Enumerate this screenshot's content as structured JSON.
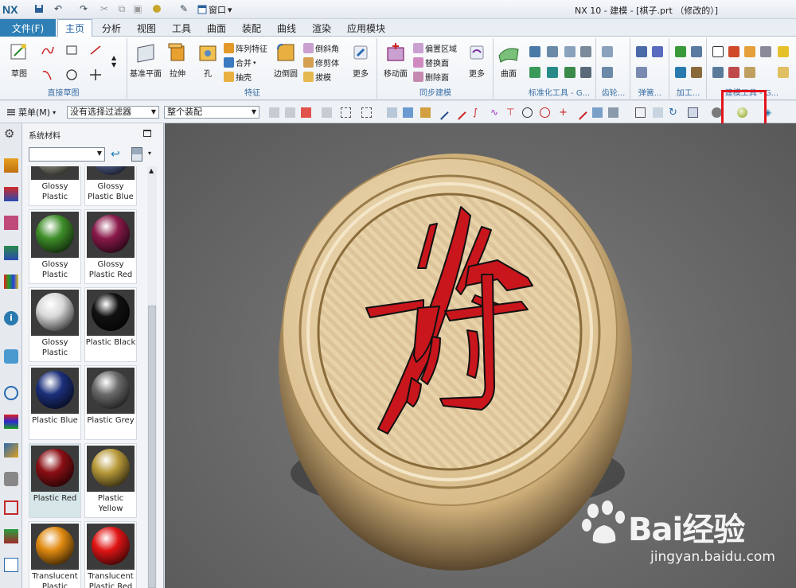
{
  "app": {
    "logo": "NX",
    "window_menu": "窗口",
    "title": "NX 10 - 建模 - [棋子.prt （修改的）]"
  },
  "tabs": {
    "file": "文件(F)",
    "items": [
      "主页",
      "分析",
      "视图",
      "工具",
      "曲面",
      "装配",
      "曲线",
      "渲染",
      "应用模块"
    ],
    "active": "主页"
  },
  "ribbon": {
    "sketch": {
      "big": "草图",
      "group": "直接草图"
    },
    "feature": {
      "datum": "基准平面",
      "extrude": "拉伸",
      "hole": "孔",
      "pattern": "阵列特征",
      "unite": "合并",
      "shell": "抽壳",
      "edge_blend": "边倒圆",
      "chamfer": "倒斜角",
      "trim_body": "修剪体",
      "draft": "拔模",
      "more": "更多",
      "group": "特征"
    },
    "sync": {
      "move_face": "移动面",
      "offset_region": "偏置区域",
      "replace_face": "替换面",
      "delete_face": "删除面",
      "more": "更多",
      "group": "同步建模"
    },
    "surface": {
      "big": "曲面"
    },
    "groups": [
      "标准化工具 - G...",
      "齿轮...",
      "弹簧...",
      "加工...",
      "建模工具 - G..."
    ]
  },
  "selbar": {
    "menu": "菜单(M)",
    "filter": "没有选择过滤器",
    "assembly": "整个装配"
  },
  "panel": {
    "title": "系统材料",
    "combo": "",
    "materials": [
      {
        "name": "Glossy Plastic",
        "color": "#9a9a8a"
      },
      {
        "name": "Glossy Plastic Blue",
        "color": "#5a6a9a"
      },
      {
        "name": "Glossy Plastic",
        "color": "#3f8f2a"
      },
      {
        "name": "Glossy Plastic Red",
        "color": "#8a1a4a"
      },
      {
        "name": "Glossy Plastic",
        "color": "#d9d9d9"
      },
      {
        "name": "Plastic Black",
        "color": "#111111"
      },
      {
        "name": "Plastic Blue",
        "color": "#1b2f7a"
      },
      {
        "name": "Plastic Grey",
        "color": "#6a6a6a"
      },
      {
        "name": "Plastic Red",
        "color": "#8a0f14"
      },
      {
        "name": "Plastic Yellow",
        "color": "#b89a3a"
      },
      {
        "name": "Translucent Plastic",
        "color": "#e08a10"
      },
      {
        "name": "Translucent Plastic Red",
        "color": "#e01515"
      }
    ],
    "selected_index": 8
  },
  "viewport": {
    "character": "将",
    "watermark": "Bai经验",
    "watermark_url": "jingyan.baidu.com"
  },
  "colors": {
    "accent": "#2e7fb5",
    "highlight": "#e3141c",
    "piece_wood": "#e3caa0",
    "character_red": "#c8161c"
  }
}
